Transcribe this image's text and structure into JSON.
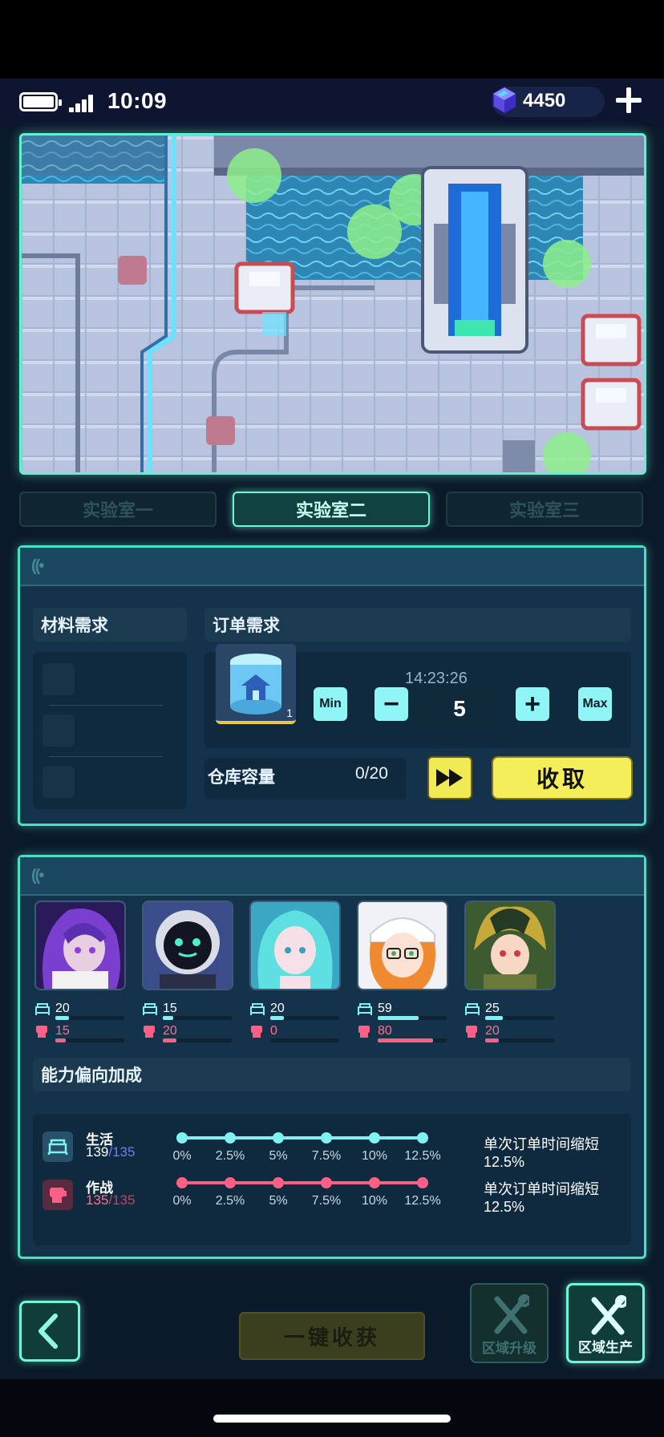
{
  "status": {
    "time": "10:09",
    "gems": "4450"
  },
  "tabs": [
    "实验室一",
    "实验室二",
    "实验室三"
  ],
  "active_tab_index": 1,
  "production": {
    "materials_title": "材料需求",
    "orders_title": "订单需求",
    "item": {
      "icon": "house-crate-icon",
      "count": "1"
    },
    "timer": "14:23:26",
    "quantity": "5",
    "min_label": "Min",
    "minus_label": "−",
    "plus_label": "+",
    "max_label": "Max",
    "capacity_label": "仓库容量",
    "capacity_value": "0/20",
    "collect_label": "收取"
  },
  "team": {
    "members": [
      {
        "name_icon": "purple-hair-girl-portrait",
        "life": "20",
        "combat": "15",
        "life_level": 0.2,
        "combat_level": 0.15
      },
      {
        "name_icon": "robot-portrait",
        "life": "15",
        "combat": "20",
        "life_level": 0.15,
        "combat_level": 0.2
      },
      {
        "name_icon": "teal-hair-girl-portrait",
        "life": "20",
        "combat": "0",
        "life_level": 0.2,
        "combat_level": 0
      },
      {
        "name_icon": "glasses-girl-portrait",
        "life": "59",
        "combat": "80",
        "life_level": 0.59,
        "combat_level": 0.8
      },
      {
        "name_icon": "armored-boy-portrait",
        "life": "25",
        "combat": "20",
        "life_level": 0.25,
        "combat_level": 0.2
      }
    ],
    "bonus_title": "能力偏向加成",
    "bonuses": [
      {
        "name": "生活",
        "score": "139",
        "max": "/135",
        "desc": "单次订单时间缩短12.5%",
        "color": "#7ff3f2",
        "score_color": "#ffffff",
        "max_color": "#6f7ff0"
      },
      {
        "name": "作战",
        "score": "135",
        "max": "/135",
        "desc": "单次订单时间缩短12.5%",
        "color": "#ff5f86",
        "score_color": "#ff6f8f",
        "max_color": "#c24565"
      }
    ],
    "ticks": [
      "0%",
      "2.5%",
      "5%",
      "7.5%",
      "10%",
      "12.5%"
    ]
  },
  "bottom": {
    "harvest_label": "一键收获",
    "upgrade_label": "区域升级",
    "produce_label": "区域生产"
  },
  "colors": {
    "accent": "#5ef2d2",
    "collect_yellow": "#f3ee5a",
    "life_cyan": "#7ff3f2",
    "combat_pink": "#ff5f86"
  }
}
